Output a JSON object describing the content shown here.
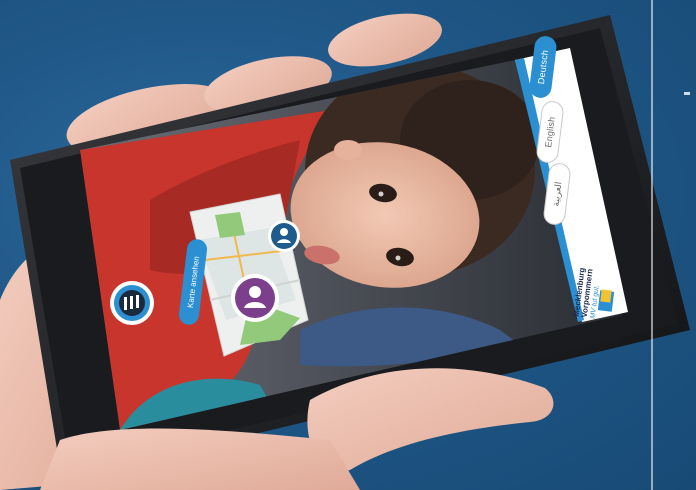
{
  "app": {
    "languages": [
      {
        "label": "Deutsch",
        "selected": true
      },
      {
        "label": "English",
        "selected": false
      },
      {
        "label": "العربية",
        "selected": false
      }
    ],
    "brand": {
      "line1": "Mecklenburg",
      "line2": "Vorpommern",
      "line3": "MV tut gut."
    },
    "action_button": "Karte ansehen"
  },
  "colors": {
    "background": "#1f5787",
    "accent": "#2b8fd1",
    "marker_purple": "#7b3f8c",
    "phone_body": "#1c1c1e"
  },
  "icons": [
    "menu-icon",
    "map-icon",
    "person-marker-icon",
    "user-marker-icon"
  ]
}
